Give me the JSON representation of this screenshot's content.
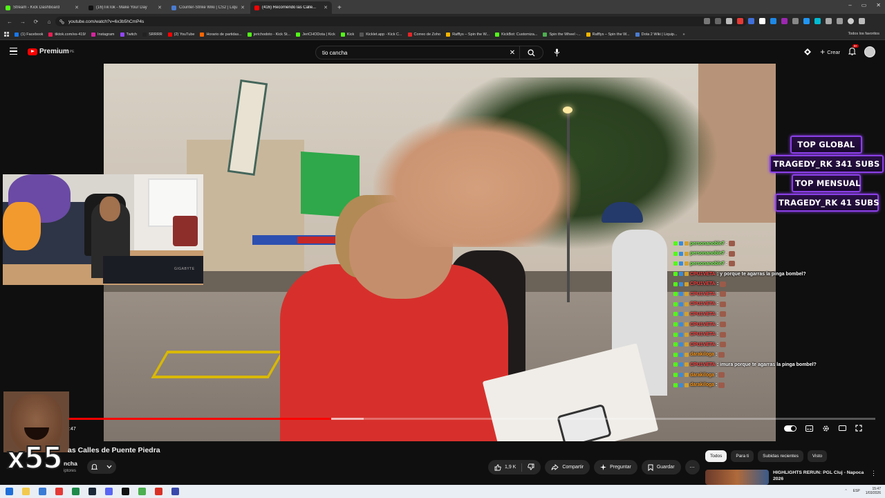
{
  "browser": {
    "tabs": [
      {
        "label": "Stream - Kick Dashboard",
        "color": "#53fc18",
        "active": false
      },
      {
        "label": "(16)TikTok - Make Your Day",
        "color": "#111111",
        "active": false
      },
      {
        "label": "Counter-Strike Wiki | CS2 | Liqu...",
        "color": "#4a7bd0",
        "active": false
      },
      {
        "label": "(416) Recorriendo las Calle...",
        "color": "#ff0000",
        "active": true
      }
    ],
    "new_tab": "+",
    "window_controls": [
      "–",
      "▭",
      "✕"
    ],
    "url": "youtube.com/watch?v=6x3b5hCmP4s",
    "nav": [
      "←",
      "→",
      "⟳",
      "⌂"
    ]
  },
  "bookmarks": {
    "items": [
      {
        "label": "(1) Facebook",
        "color": "#1877f2"
      },
      {
        "label": "tiktok.com/es-419/",
        "color": "#ee1d52"
      },
      {
        "label": "Instagram",
        "color": "#d6249f"
      },
      {
        "label": "Twitch",
        "color": "#9146ff"
      },
      {
        "label": "SRRRR",
        "color": "#222222"
      },
      {
        "label": "(2) YouTube",
        "color": "#ff0000"
      },
      {
        "label": "Horario de partidas...",
        "color": "#ff6600"
      },
      {
        "label": "jerichodoto - Kick St...",
        "color": "#53fc18"
      },
      {
        "label": "JeriCHODota | Kick",
        "color": "#53fc18"
      },
      {
        "label": "Kick",
        "color": "#53fc18"
      },
      {
        "label": "Kicklet.app - Kick C...",
        "color": "#555555"
      },
      {
        "label": "Correo de Zoho",
        "color": "#e42527"
      },
      {
        "label": "Rafflys – Spin the W...",
        "color": "#f6b400"
      },
      {
        "label": "KickBot: Customiza...",
        "color": "#53fc18"
      },
      {
        "label": "Spin the Wheel -...",
        "color": "#4caf50"
      },
      {
        "label": "Rafflys – Spin the W...",
        "color": "#f6b400"
      },
      {
        "label": "Dota 2 Wiki | Liquip...",
        "color": "#4a7bd0"
      }
    ],
    "more": "»",
    "all_bookmarks": "Todos los favoritos"
  },
  "youtube": {
    "logo_text": "Premium",
    "region": "PE",
    "search": {
      "value": "tio cancha",
      "clear_icon": "✕"
    },
    "create_label": "Crear",
    "notification_count": "9+",
    "video": {
      "time": ":47",
      "progress_fraction": 0.325,
      "buffer_fraction": 0.04
    },
    "title": "as Calles de Puente Piedra",
    "channel_name": "ncha",
    "channel_subs": "iptores",
    "actions": {
      "likes": "1,9 K",
      "share": "Compartir",
      "ask": "Preguntar",
      "save": "Guardar",
      "more": "⋯"
    },
    "chips": [
      "Todos",
      "Para ti",
      "Subidas recientes",
      "Visto"
    ],
    "recommendation": {
      "title": "HIGHLIGHTS RERUN: PGL Cluj - Napoca 2026"
    }
  },
  "overlay": {
    "top_global_label": "TOP GLOBAL",
    "top_global_name": "TRAGEDY_RK 341 SUBS",
    "top_month_label": "TOP MENSUAL",
    "top_month_name": "TRAGEDY_RK 41 SUBS",
    "emote_count": "x55",
    "webcam_brand": "GIGABYTE",
    "chat": [
      {
        "user": "personanoble7",
        "color": "green",
        "text": ""
      },
      {
        "user": "personanoble7",
        "color": "green",
        "text": ""
      },
      {
        "user": "personanoble7",
        "color": "green",
        "text": ""
      },
      {
        "user": "CPU1VETA",
        "color": "red",
        "text": "y porque te agarras la pinga bombel?"
      },
      {
        "user": "CPU1VETA",
        "color": "red",
        "text": ""
      },
      {
        "user": "CPU1VETA",
        "color": "red",
        "text": ""
      },
      {
        "user": "CPU1VETA",
        "color": "red",
        "text": ""
      },
      {
        "user": "CPU1VETA",
        "color": "red",
        "text": ""
      },
      {
        "user": "CPU1VETA",
        "color": "red",
        "text": ""
      },
      {
        "user": "CPU1VETA",
        "color": "red",
        "text": ""
      },
      {
        "user": "CPU1VETA",
        "color": "red",
        "text": ""
      },
      {
        "user": "darakiloga",
        "color": "orange",
        "text": ""
      },
      {
        "user": "CPU1VETA",
        "color": "red",
        "text": "imura porque te agarras la pinga bombel?"
      },
      {
        "user": "darakiloga",
        "color": "orange",
        "text": ""
      },
      {
        "user": "darakiloga",
        "color": "orange",
        "text": ""
      }
    ]
  },
  "taskbar": {
    "icons": [
      "windows-icon",
      "file-explorer-icon",
      "store-icon",
      "opera-icon",
      "excel-icon",
      "steam-icon",
      "discord-icon",
      "capcut-icon",
      "chrome-icon",
      "chrome-red-icon",
      "notepad-icon"
    ],
    "language": "ESP",
    "time": "15:47",
    "date": "1/03/2026"
  }
}
